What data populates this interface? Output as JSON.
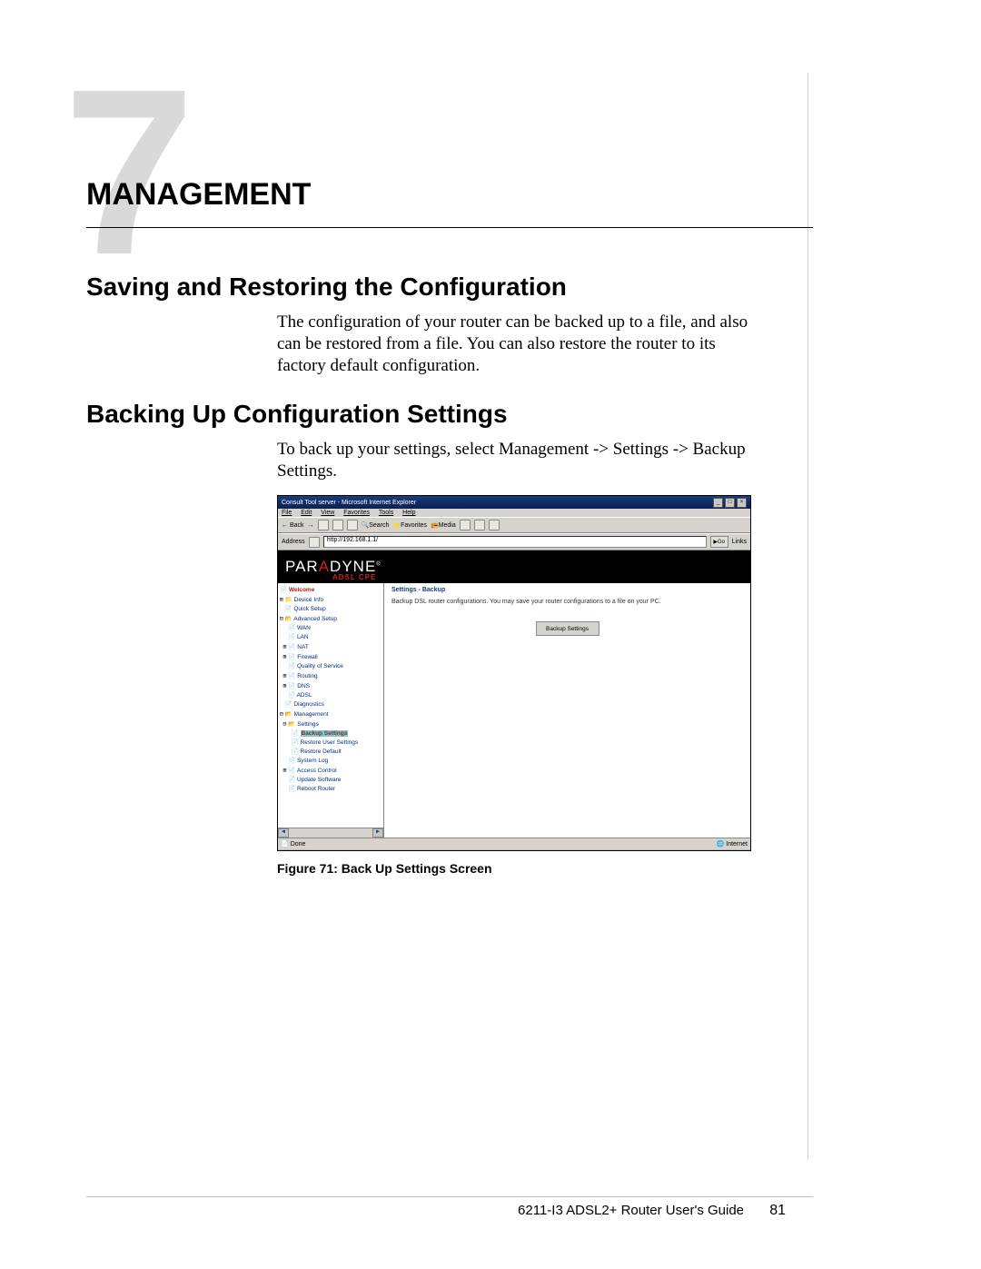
{
  "chapter": {
    "number": "7",
    "title": "MANAGEMENT"
  },
  "sections": {
    "s1_title": "Saving and Restoring the Configuration",
    "s1_body": "The configuration of your router can be backed up to a file, and also can be restored from a file. You can also restore the router to its factory default configuration.",
    "s2_title": "Backing Up Configuration Settings",
    "s2_body": "To back up your settings, select Management -> Settings -> Backup Settings."
  },
  "screenshot": {
    "window_title": "Consult Tool server - Microsoft Internet Explorer",
    "menus": {
      "file": "File",
      "edit": "Edit",
      "view": "View",
      "favorites": "Favorites",
      "tools": "Tools",
      "help": "Help"
    },
    "toolbar": {
      "back": "Back",
      "search": "Search",
      "favorites": "Favorites",
      "media": "Media"
    },
    "address_label": "Address",
    "address_value": "http://192.168.1.1/",
    "go_label": "Go",
    "links_label": "Links",
    "brand": {
      "name": "PARADYNE",
      "sub": "ADSL CPE"
    },
    "nav": {
      "welcome": "Welcome",
      "device_info": "Device Info",
      "quick_setup": "Quick Setup",
      "advanced_setup": "Advanced Setup",
      "wan": "WAN",
      "lan": "LAN",
      "nat": "NAT",
      "firewall": "Firewall",
      "qos": "Quality of Service",
      "routing": "Routing",
      "dns": "DNS",
      "adsl": "ADSL",
      "diagnostics": "Diagnostics",
      "management": "Management",
      "settings": "Settings",
      "backup_settings": "Backup Settings",
      "restore_user": "Restore User Settings",
      "restore_default": "Restore Default",
      "system_log": "System Log",
      "access_control": "Access Control",
      "update_software": "Update Software",
      "reboot": "Reboot Router"
    },
    "panel": {
      "title": "Settings - Backup",
      "text": "Backup DSL router configurations. You may save your router configurations to a file on your PC.",
      "button": "Backup Settings"
    },
    "status": {
      "left": "Done",
      "right": "Internet"
    }
  },
  "figure_caption": "Figure 71: Back Up Settings Screen",
  "footer": {
    "guide": "6211-I3 ADSL2+ Router User's Guide",
    "page": "81"
  }
}
